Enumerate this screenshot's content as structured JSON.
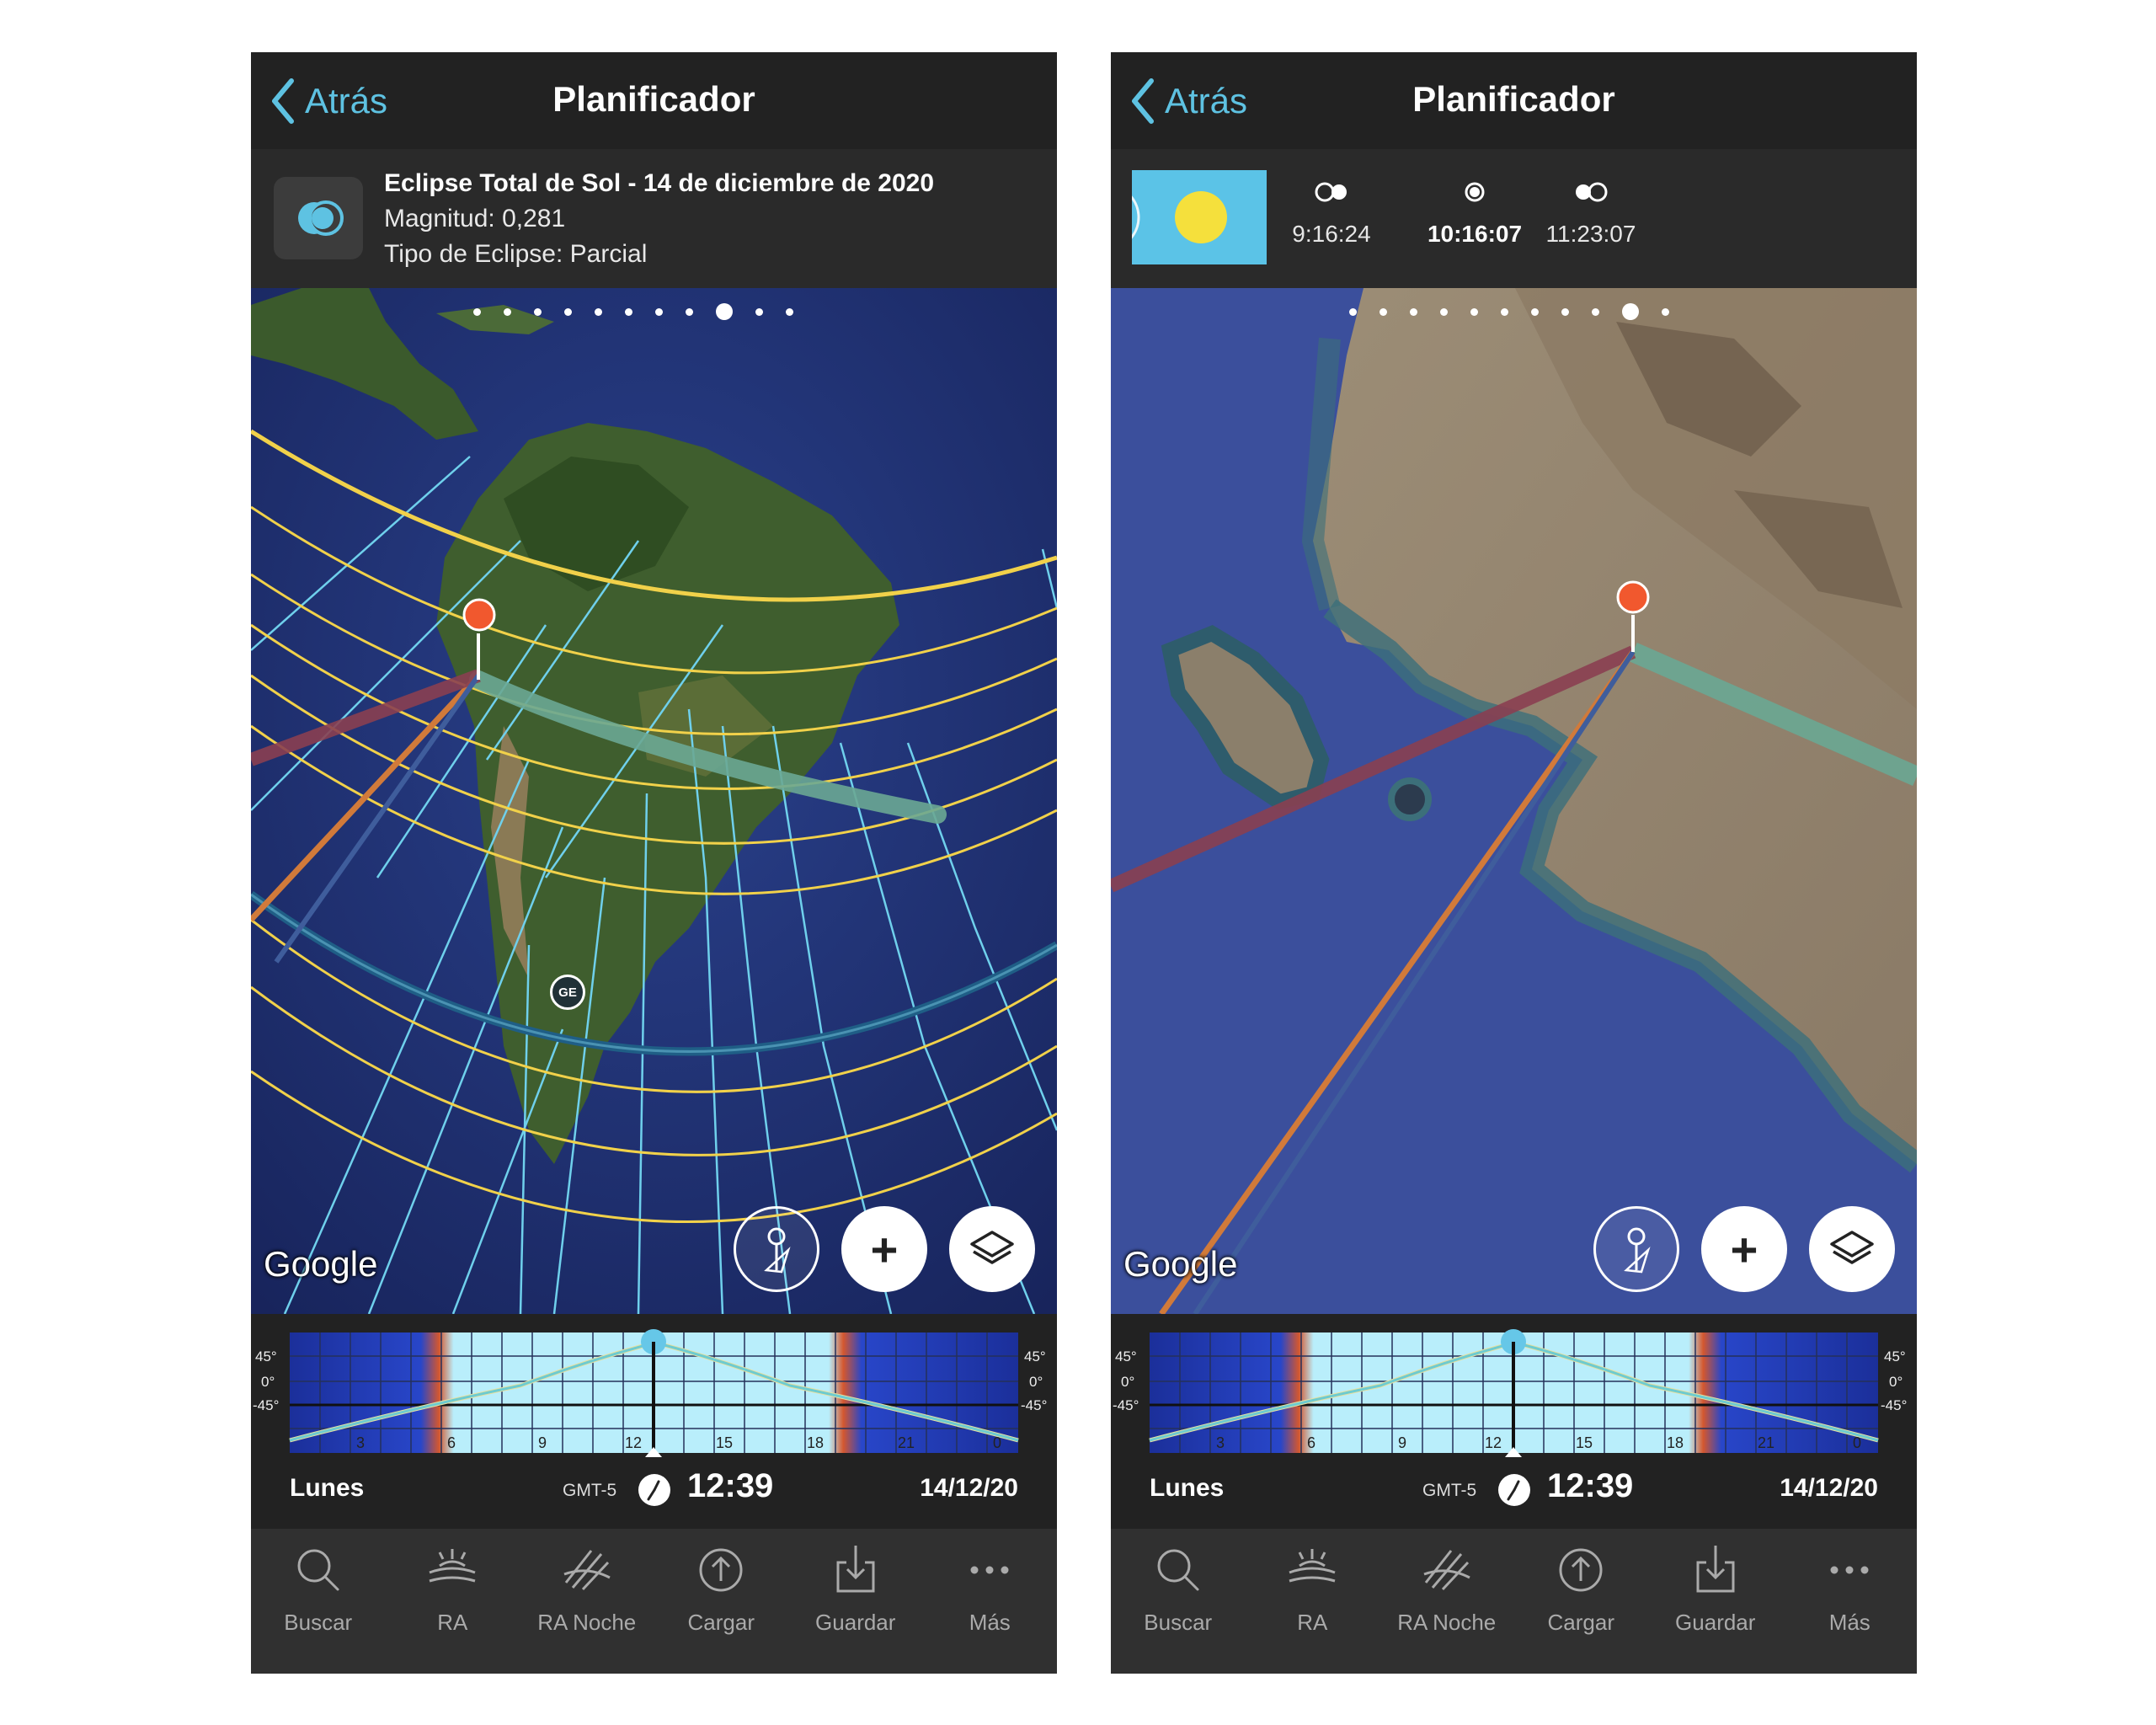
{
  "colors": {
    "accent": "#5ec2e2",
    "pin": "#f1582e",
    "bar": "#222222",
    "tabbar": "#303030",
    "sun": "#f5e03c",
    "sky": "#5bc3e7",
    "path_centerline": "#6aa793",
    "line_sun": "#d17a3a",
    "line_moon": "#8a3f51"
  },
  "left_screen": {
    "back_label": "Atrás",
    "title": "Planificador",
    "info": {
      "line1": "Eclipse Total de Sol - 14 de diciembre de 2020",
      "line2": "Magnitud: 0,281",
      "line3": "Tipo de Eclipse: Parcial"
    },
    "map": {
      "pager_dots": 11,
      "pager_active": 8,
      "marker_label": "GE",
      "attribution": "Google"
    },
    "timeline": {
      "left_axis": [
        "45°",
        "0°",
        "-45°"
      ],
      "right_axis": [
        "45°",
        "0°",
        "-45°"
      ],
      "hours": [
        "3",
        "6",
        "9",
        "12",
        "15",
        "18",
        "21",
        "0"
      ]
    },
    "footer": {
      "day": "Lunes",
      "timezone": "GMT-5",
      "time": "12:39",
      "date": "14/12/20"
    },
    "tabs": [
      {
        "label": "Buscar",
        "icon": "search-icon"
      },
      {
        "label": "RA",
        "icon": "ar-icon"
      },
      {
        "label": "RA Noche",
        "icon": "ar-night-icon"
      },
      {
        "label": "Cargar",
        "icon": "upload-icon"
      },
      {
        "label": "Guardar",
        "icon": "download-icon"
      },
      {
        "label": "Más",
        "icon": "more-icon"
      }
    ]
  },
  "right_screen": {
    "back_label": "Atrás",
    "title": "Planificador",
    "phases": [
      {
        "icon": "partial-start-icon",
        "time": "9:16:24"
      },
      {
        "icon": "max-eclipse-icon",
        "time": "10:16:07"
      },
      {
        "icon": "partial-end-icon",
        "time": "11:23:07"
      }
    ],
    "map": {
      "pager_dots": 11,
      "pager_active": 9,
      "attribution": "Google"
    },
    "timeline": {
      "left_axis": [
        "45°",
        "0°",
        "-45°"
      ],
      "right_axis": [
        "45°",
        "0°",
        "-45°"
      ],
      "hours": [
        "3",
        "6",
        "9",
        "12",
        "15",
        "18",
        "21",
        "0"
      ]
    },
    "footer": {
      "day": "Lunes",
      "timezone": "GMT-5",
      "time": "12:39",
      "date": "14/12/20"
    },
    "tabs": [
      {
        "label": "Buscar",
        "icon": "search-icon"
      },
      {
        "label": "RA",
        "icon": "ar-icon"
      },
      {
        "label": "RA Noche",
        "icon": "ar-night-icon"
      },
      {
        "label": "Cargar",
        "icon": "upload-icon"
      },
      {
        "label": "Guardar",
        "icon": "download-icon"
      },
      {
        "label": "Más",
        "icon": "more-icon"
      }
    ]
  }
}
